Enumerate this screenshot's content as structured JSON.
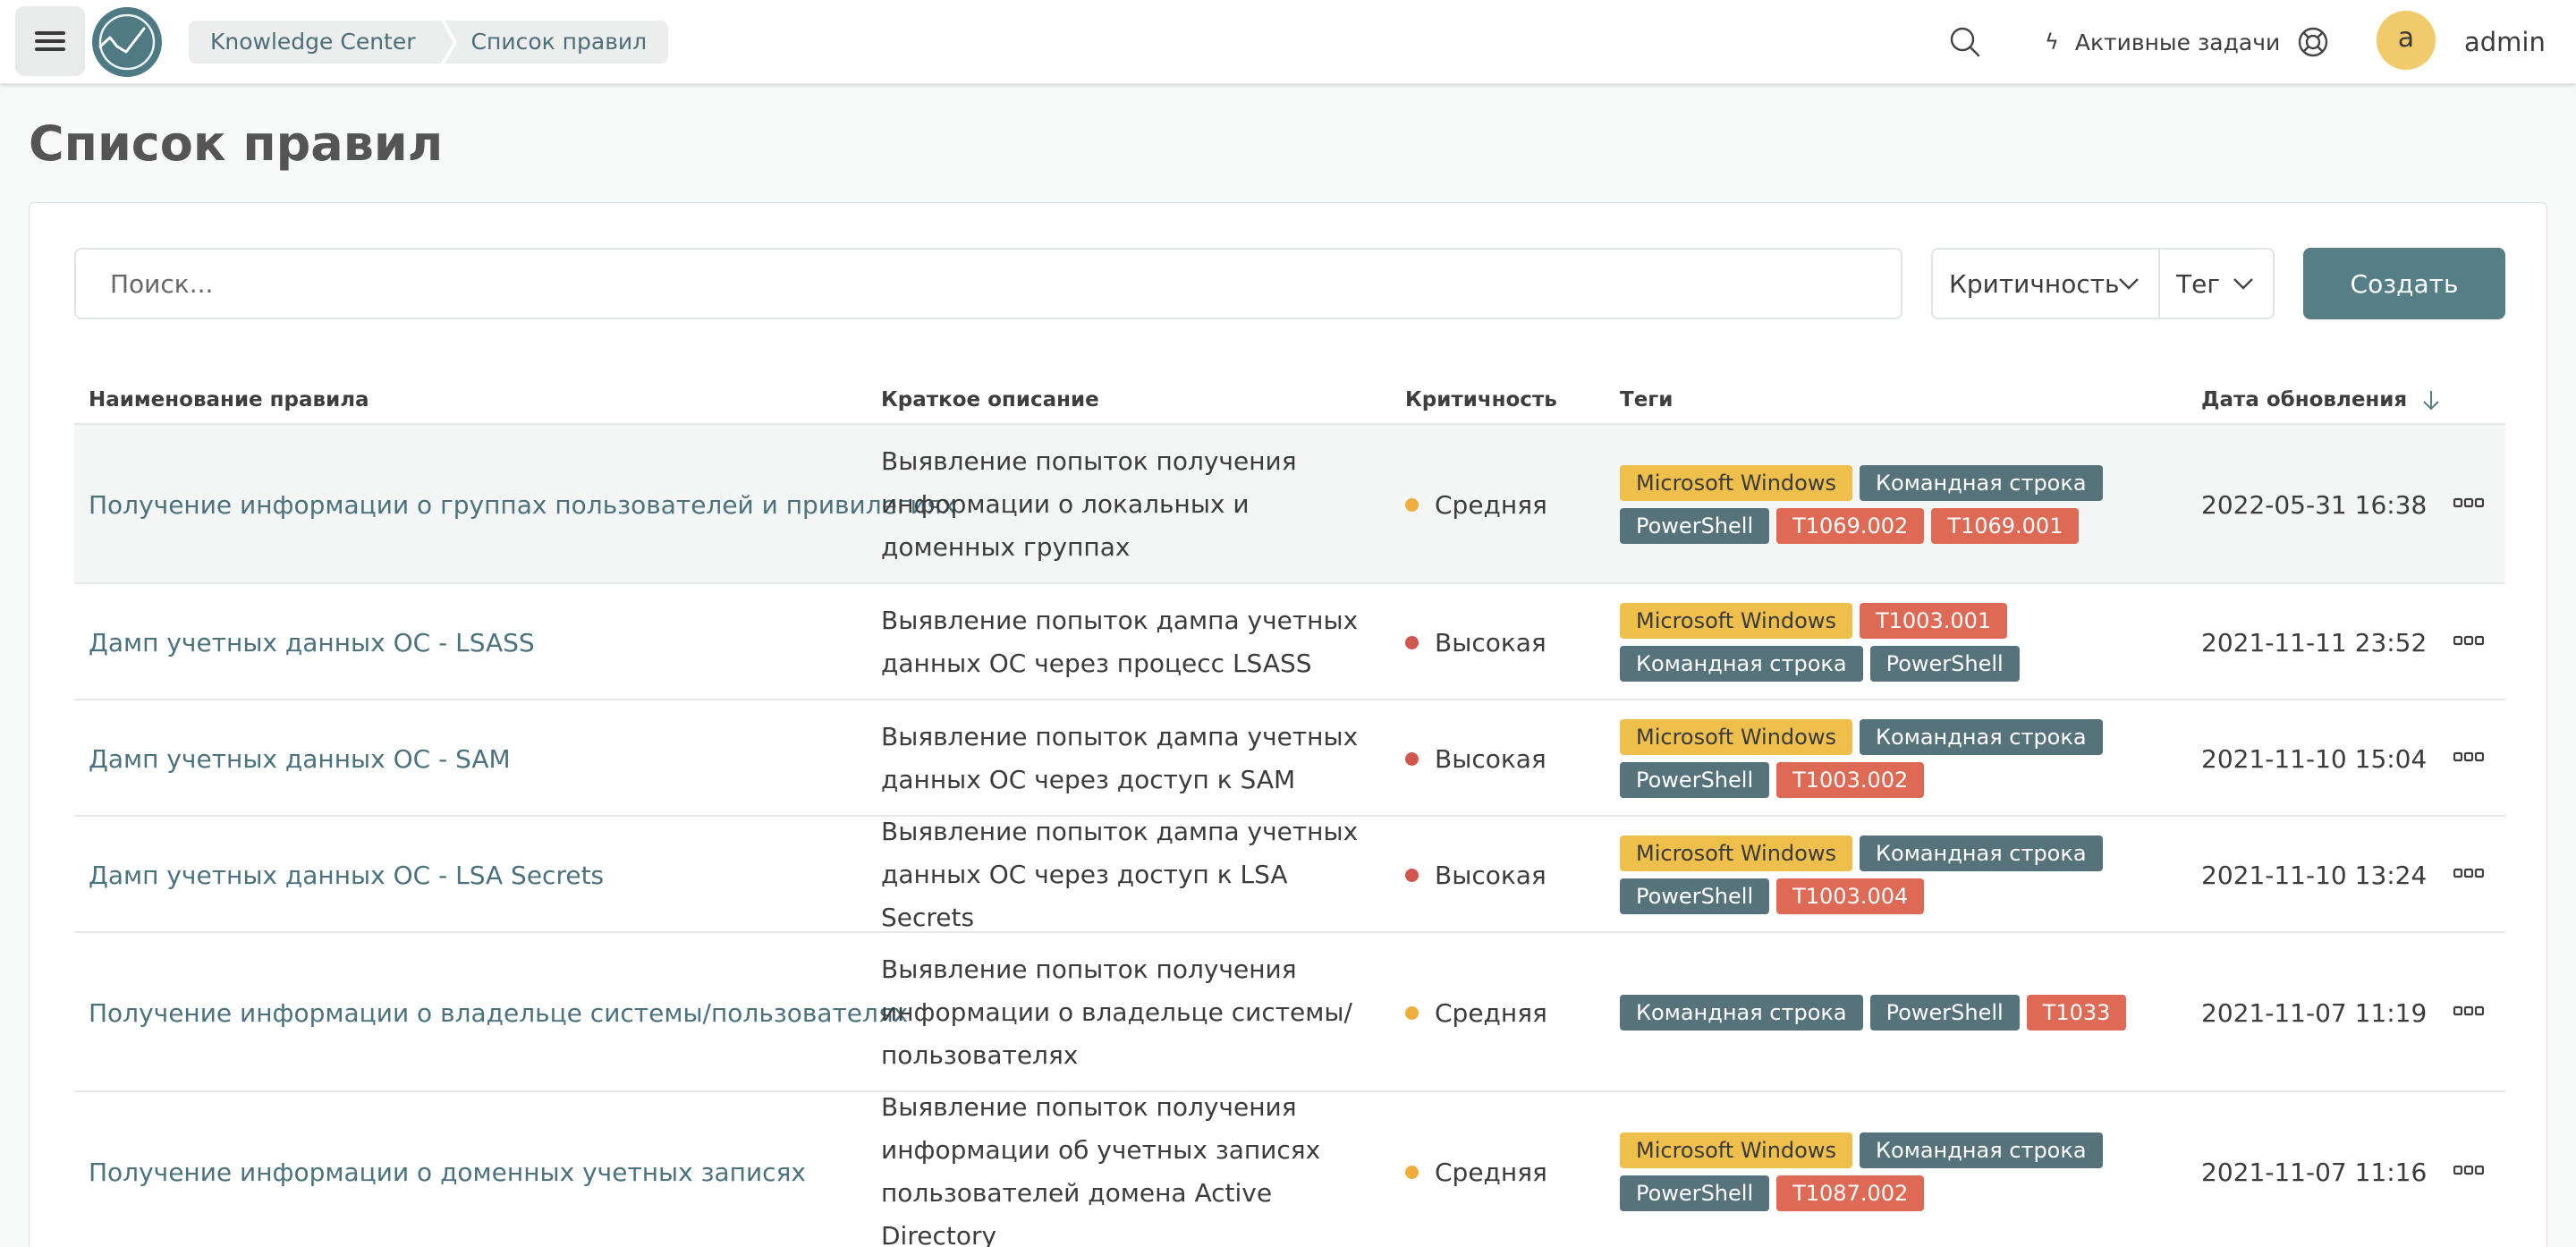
{
  "header": {
    "breadcrumb": [
      "Knowledge Center",
      "Список правил"
    ],
    "tasks_label": "Активные задачи",
    "avatar_letter": "a",
    "username": "admin"
  },
  "page": {
    "title": "Список правил"
  },
  "toolbar": {
    "search_placeholder": "Поиск...",
    "filter_severity": "Критичность",
    "filter_tag": "Тег",
    "create_label": "Создать"
  },
  "table": {
    "columns": {
      "name": "Наименование правила",
      "description": "Краткое описание",
      "severity": "Критичность",
      "tags": "Теги",
      "updated": "Дата обновления"
    },
    "rows": [
      {
        "name": "Получение информации о группах пользователей и привилегиях",
        "description": "Выявление попыток получения информации о локальных и доменных группах",
        "severity": "Средняя",
        "severity_level": "medium",
        "tags": [
          {
            "label": "Microsoft Windows",
            "kind": "win"
          },
          {
            "label": "Командная строка",
            "kind": "gray"
          },
          {
            "label": "PowerShell",
            "kind": "gray"
          },
          {
            "label": "T1069.002",
            "kind": "red"
          },
          {
            "label": "T1069.001",
            "kind": "red"
          }
        ],
        "updated": "2022-05-31 16:38"
      },
      {
        "name": "Дамп учетных данных ОС - LSASS",
        "description": "Выявление попыток дампа учетных данных ОС через процесс LSASS",
        "severity": "Высокая",
        "severity_level": "high",
        "tags": [
          {
            "label": "Microsoft Windows",
            "kind": "win"
          },
          {
            "label": "T1003.001",
            "kind": "red"
          },
          {
            "label": "Командная строка",
            "kind": "gray"
          },
          {
            "label": "PowerShell",
            "kind": "gray"
          }
        ],
        "updated": "2021-11-11 23:52"
      },
      {
        "name": "Дамп учетных данных ОС - SAM",
        "description": "Выявление попыток дампа учетных данных ОС через доступ к SAM",
        "severity": "Высокая",
        "severity_level": "high",
        "tags": [
          {
            "label": "Microsoft Windows",
            "kind": "win"
          },
          {
            "label": "Командная строка",
            "kind": "gray"
          },
          {
            "label": "PowerShell",
            "kind": "gray"
          },
          {
            "label": "T1003.002",
            "kind": "red"
          }
        ],
        "updated": "2021-11-10 15:04"
      },
      {
        "name": "Дамп учетных данных ОС - LSA Secrets",
        "description": "Выявление попыток дампа учетных данных ОС через доступ к LSA Secrets",
        "severity": "Высокая",
        "severity_level": "high",
        "tags": [
          {
            "label": "Microsoft Windows",
            "kind": "win"
          },
          {
            "label": "Командная строка",
            "kind": "gray"
          },
          {
            "label": "PowerShell",
            "kind": "gray"
          },
          {
            "label": "T1003.004",
            "kind": "red"
          }
        ],
        "updated": "2021-11-10 13:24"
      },
      {
        "name": "Получение информации о владельце системы/пользователях",
        "description": "Выявление попыток получения информации о владельце системы/ пользователях",
        "severity": "Средняя",
        "severity_level": "medium",
        "tags": [
          {
            "label": "Командная строка",
            "kind": "gray"
          },
          {
            "label": "PowerShell",
            "kind": "gray"
          },
          {
            "label": "T1033",
            "kind": "red"
          }
        ],
        "updated": "2021-11-07 11:19"
      },
      {
        "name": "Получение информации о доменных учетных записях",
        "description": "Выявление попыток получения информации об учетных записях пользователей домена Active Directory",
        "severity": "Средняя",
        "severity_level": "medium",
        "tags": [
          {
            "label": "Microsoft Windows",
            "kind": "win"
          },
          {
            "label": "Командная строка",
            "kind": "gray"
          },
          {
            "label": "PowerShell",
            "kind": "gray"
          },
          {
            "label": "T1087.002",
            "kind": "red"
          }
        ],
        "updated": "2021-11-07 11:16"
      }
    ]
  }
}
